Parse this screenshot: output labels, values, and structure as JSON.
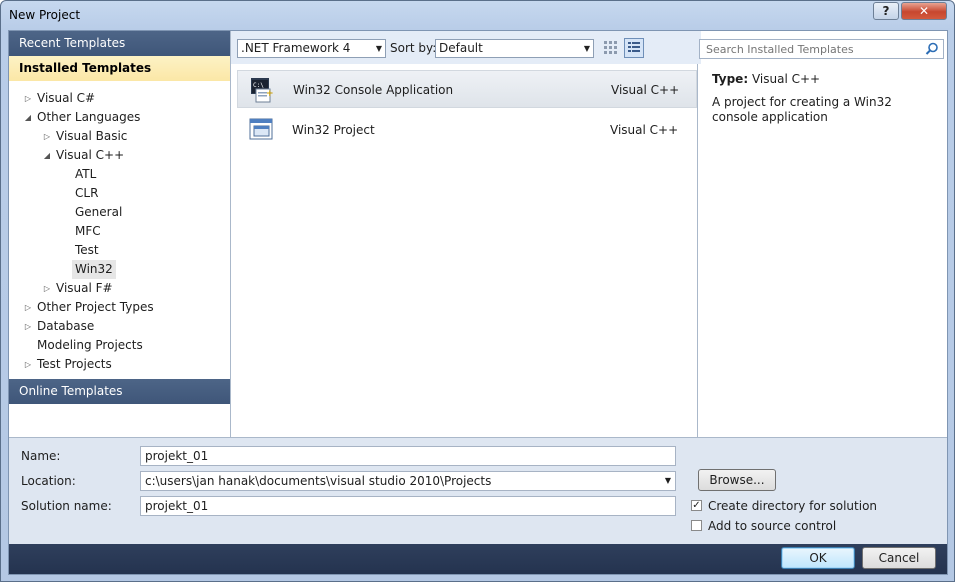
{
  "window": {
    "title": "New Project"
  },
  "left": {
    "recent": "Recent Templates",
    "installed": "Installed Templates",
    "online": "Online Templates",
    "tree": [
      {
        "label": "Visual C#",
        "indent": 0,
        "arrow": "right"
      },
      {
        "label": "Other Languages",
        "indent": 0,
        "arrow": "down"
      },
      {
        "label": "Visual Basic",
        "indent": 1,
        "arrow": "right"
      },
      {
        "label": "Visual C++",
        "indent": 1,
        "arrow": "down"
      },
      {
        "label": "ATL",
        "indent": 2,
        "arrow": ""
      },
      {
        "label": "CLR",
        "indent": 2,
        "arrow": ""
      },
      {
        "label": "General",
        "indent": 2,
        "arrow": ""
      },
      {
        "label": "MFC",
        "indent": 2,
        "arrow": ""
      },
      {
        "label": "Test",
        "indent": 2,
        "arrow": ""
      },
      {
        "label": "Win32",
        "indent": 2,
        "arrow": "",
        "selected": true
      },
      {
        "label": "Visual F#",
        "indent": 1,
        "arrow": "right"
      },
      {
        "label": "Other Project Types",
        "indent": 0,
        "arrow": "right"
      },
      {
        "label": "Database",
        "indent": 0,
        "arrow": "right"
      },
      {
        "label": "Modeling Projects",
        "indent": 0,
        "arrow": ""
      },
      {
        "label": "Test Projects",
        "indent": 0,
        "arrow": "right"
      }
    ]
  },
  "toolbar": {
    "framework": ".NET Framework 4",
    "sort_label": "Sort by:",
    "sort_value": "Default"
  },
  "search": {
    "placeholder": "Search Installed Templates"
  },
  "templates": [
    {
      "name": "Win32 Console Application",
      "lang": "Visual C++",
      "icon": "console-app-icon",
      "selected": true
    },
    {
      "name": "Win32 Project",
      "lang": "Visual C++",
      "icon": "win32-project-icon",
      "selected": false
    }
  ],
  "details": {
    "type_label": "Type:",
    "type_value": "Visual C++",
    "description": "A project for creating a Win32 console application"
  },
  "form": {
    "name_label": "Name:",
    "name_value": "projekt_01",
    "location_label": "Location:",
    "location_value": "c:\\users\\jan hanak\\documents\\visual studio 2010\\Projects",
    "solution_label": "Solution name:",
    "solution_value": "projekt_01",
    "browse": "Browse...",
    "create_dir": "Create directory for solution",
    "create_dir_checked": true,
    "source_control": "Add to source control",
    "source_control_checked": false
  },
  "buttons": {
    "ok": "OK",
    "cancel": "Cancel"
  }
}
